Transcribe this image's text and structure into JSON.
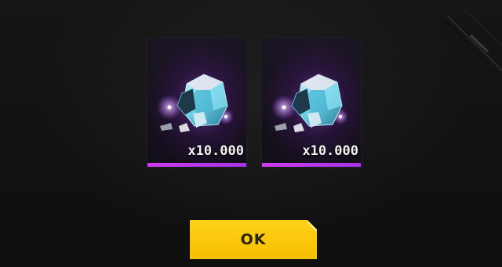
{
  "rewards": {
    "items": [
      {
        "icon": "diamond-pile-icon",
        "quantity": "x10.000",
        "rarity_color": "#c23ce8"
      },
      {
        "icon": "diamond-pile-icon",
        "quantity": "x10.000",
        "rarity_color": "#c23ce8"
      }
    ]
  },
  "ok_button": {
    "label": "OK",
    "color": "#f9c300"
  }
}
